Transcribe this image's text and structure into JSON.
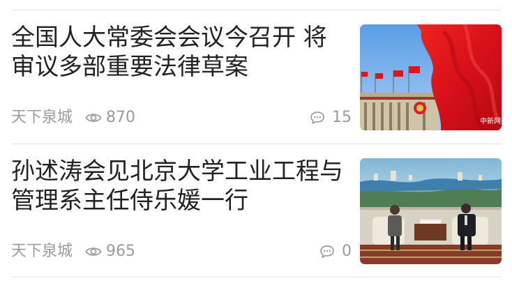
{
  "news": [
    {
      "title_line1": "全国人大常委会会议今召开 将",
      "title_line2": "审议多部重要法律草案",
      "source": "天下泉城",
      "views": "870",
      "comments": "15",
      "thumbnail_icon": "red-flags-great-hall-photo",
      "watermark": "中新网"
    },
    {
      "title_line1": "孙述涛会见北京大学工业工程与",
      "title_line2": "管理系主任侍乐媛一行",
      "source": "天下泉城",
      "views": "965",
      "comments": "0",
      "thumbnail_icon": "meeting-room-photo"
    }
  ],
  "colors": {
    "title": "#222222",
    "meta": "#9b9b9b",
    "divider": "#e3e3e3",
    "flag_red": "#e8141b"
  }
}
